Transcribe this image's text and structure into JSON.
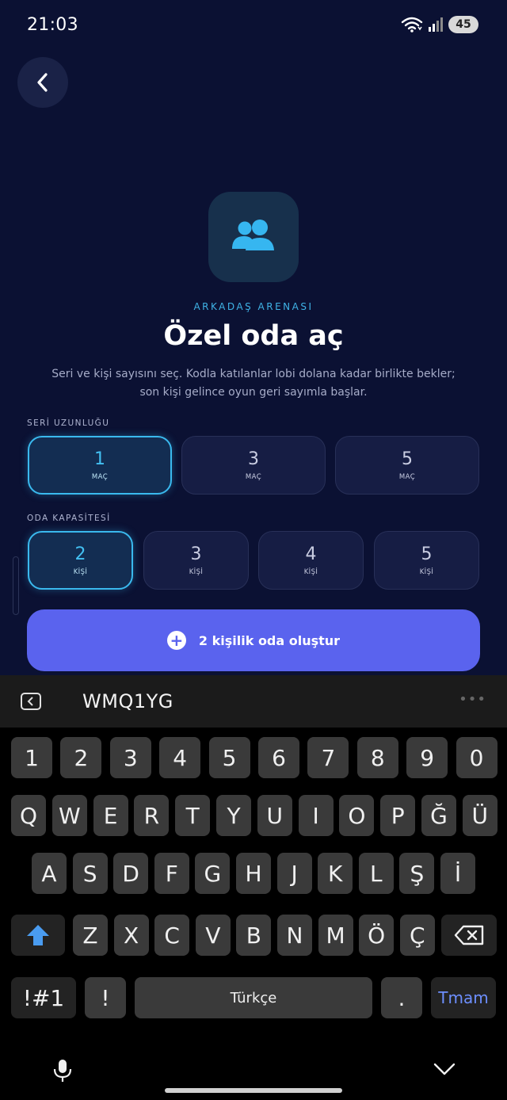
{
  "status": {
    "time": "21:03",
    "battery": "45"
  },
  "header": {
    "back_icon": "chevron-left-icon"
  },
  "hero": {
    "icon": "people-icon",
    "eyebrow": "ARKADAŞ ARENASI",
    "title": "Özel oda aç",
    "subtitle_line1": "Seri ve kişi sayısını seç. Kodla katılanlar lobi dolana kadar birlikte bekler;",
    "subtitle_line2": "son kişi gelince oyun geri sayımla başlar."
  },
  "series": {
    "label": "SERİ UZUNLUĞU",
    "options": [
      {
        "value": "1",
        "unit": "MAÇ",
        "selected": true
      },
      {
        "value": "3",
        "unit": "MAÇ",
        "selected": false
      },
      {
        "value": "5",
        "unit": "MAÇ",
        "selected": false
      }
    ]
  },
  "capacity": {
    "label": "ODA KAPASİTESİ",
    "options": [
      {
        "value": "2",
        "unit": "KİŞİ",
        "selected": true
      },
      {
        "value": "3",
        "unit": "KİŞİ",
        "selected": false
      },
      {
        "value": "4",
        "unit": "KİŞİ",
        "selected": false
      },
      {
        "value": "5",
        "unit": "KİŞİ",
        "selected": false
      }
    ]
  },
  "create_button": {
    "label": "2 kişilik oda oluştur",
    "icon": "plus-circle-icon"
  },
  "keyboard": {
    "suggestion": "WMQ1YG",
    "more": "•••",
    "row_numbers": [
      "1",
      "2",
      "3",
      "4",
      "5",
      "6",
      "7",
      "8",
      "9",
      "0"
    ],
    "row1": [
      "Q",
      "W",
      "E",
      "R",
      "T",
      "Y",
      "U",
      "I",
      "O",
      "P",
      "Ğ",
      "Ü"
    ],
    "row2": [
      "A",
      "S",
      "D",
      "F",
      "G",
      "H",
      "J",
      "K",
      "L",
      "Ş",
      "İ"
    ],
    "row3": [
      "Z",
      "X",
      "C",
      "V",
      "B",
      "N",
      "M",
      "Ö",
      "Ç"
    ],
    "symbols_label": "!#1",
    "exclaim_label": "!",
    "space_label": "Türkçe",
    "period_label": ".",
    "done_label": "Tmam",
    "shift_icon": "shift-icon",
    "backspace_icon": "backspace-icon",
    "mic_icon": "microphone-icon",
    "hide_icon": "chevron-down-icon"
  },
  "colors": {
    "accent": "#3ab9ee",
    "primary_button": "#5a63ee",
    "background": "#0b1133"
  }
}
